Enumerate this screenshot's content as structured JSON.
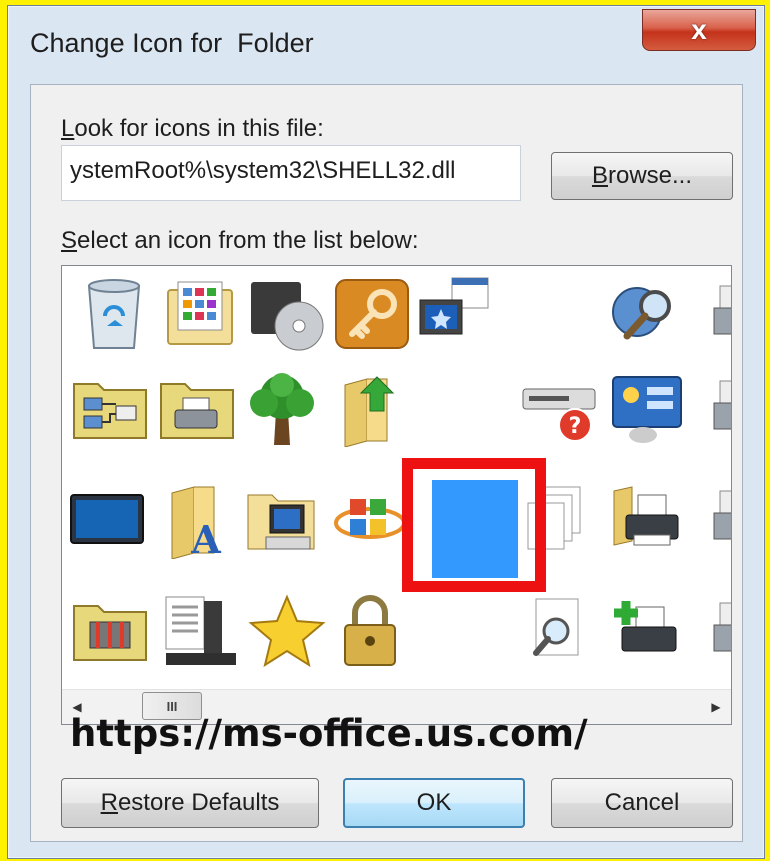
{
  "window": {
    "title": "Change Icon for  Folder",
    "close_label": "x"
  },
  "file_section": {
    "label": "Look for icons in this file:",
    "path_value": "ystemRoot%\\system32\\SHELL32.dll",
    "browse_label": "Browse..."
  },
  "list_section": {
    "label": "Select an icon from the list below:"
  },
  "icons": [
    "recycle-bin-icon",
    "control-panel-folder-icon",
    "media-disc-icon",
    "key-icon",
    "remote-desktop-icon",
    "magnifier-globe-icon",
    "printer-partial-icon",
    "network-folder-icon",
    "printers-folder-icon",
    "tree-icon",
    "folder-up-arrow-icon",
    "help-device-icon",
    "control-panel-icon",
    "printer-partial-icon",
    "monitor-icon",
    "fonts-folder-icon",
    "computer-folder-icon",
    "windows-logo-icon",
    "blank-selected-icon",
    "copy-documents-icon",
    "printer-icon",
    "printer-partial-icon",
    "tools-folder-icon",
    "document-list-icon",
    "star-icon",
    "padlock-icon",
    "search-document-icon",
    "add-printer-icon",
    "printer-partial-icon"
  ],
  "selected_icon_color": "#3399ff",
  "highlight_color": "#ee1111",
  "scrollbar": {
    "thumb_label": "III"
  },
  "buttons": {
    "restore": "Restore Defaults",
    "ok": "OK",
    "cancel": "Cancel"
  },
  "watermark": "https://ms-office.us.com/"
}
